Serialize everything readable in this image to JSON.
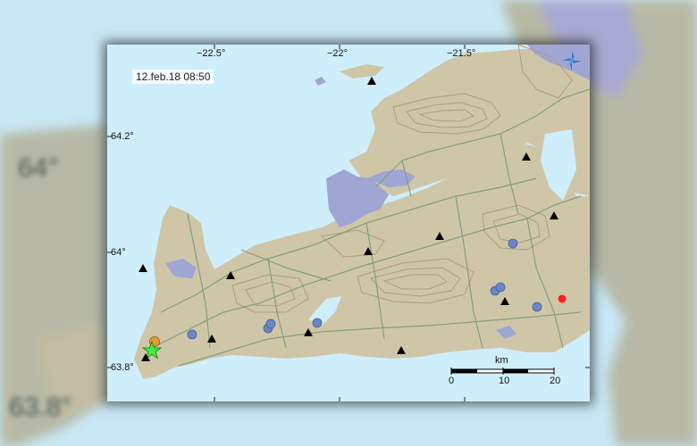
{
  "map": {
    "timestamp": "12.feb.18  08:50",
    "lon_labels": [
      "−22.5°",
      "−22°",
      "−21.5°"
    ],
    "lat_labels": [
      "64.2°",
      "64°",
      "63.8°"
    ],
    "scale": {
      "unit": "km",
      "ticks": [
        "0",
        "10",
        "20"
      ]
    },
    "backdrop_labels": [
      "64°",
      "63.8°"
    ],
    "colors": {
      "sea": "#cfeefb",
      "land": "#cfc6a8",
      "contour": "#b09a80",
      "road": "#7f9f7f",
      "lava": "#a0a6d4",
      "quake_dot": "#6b86c6",
      "quake_recent": "#e79a2e",
      "quake_latest": "#ff2020",
      "large_quake_star": "#44ee44",
      "station": "#000000"
    },
    "icons": [
      "compass-icon",
      "seismic-station-icon",
      "large-quake-star-icon"
    ]
  }
}
